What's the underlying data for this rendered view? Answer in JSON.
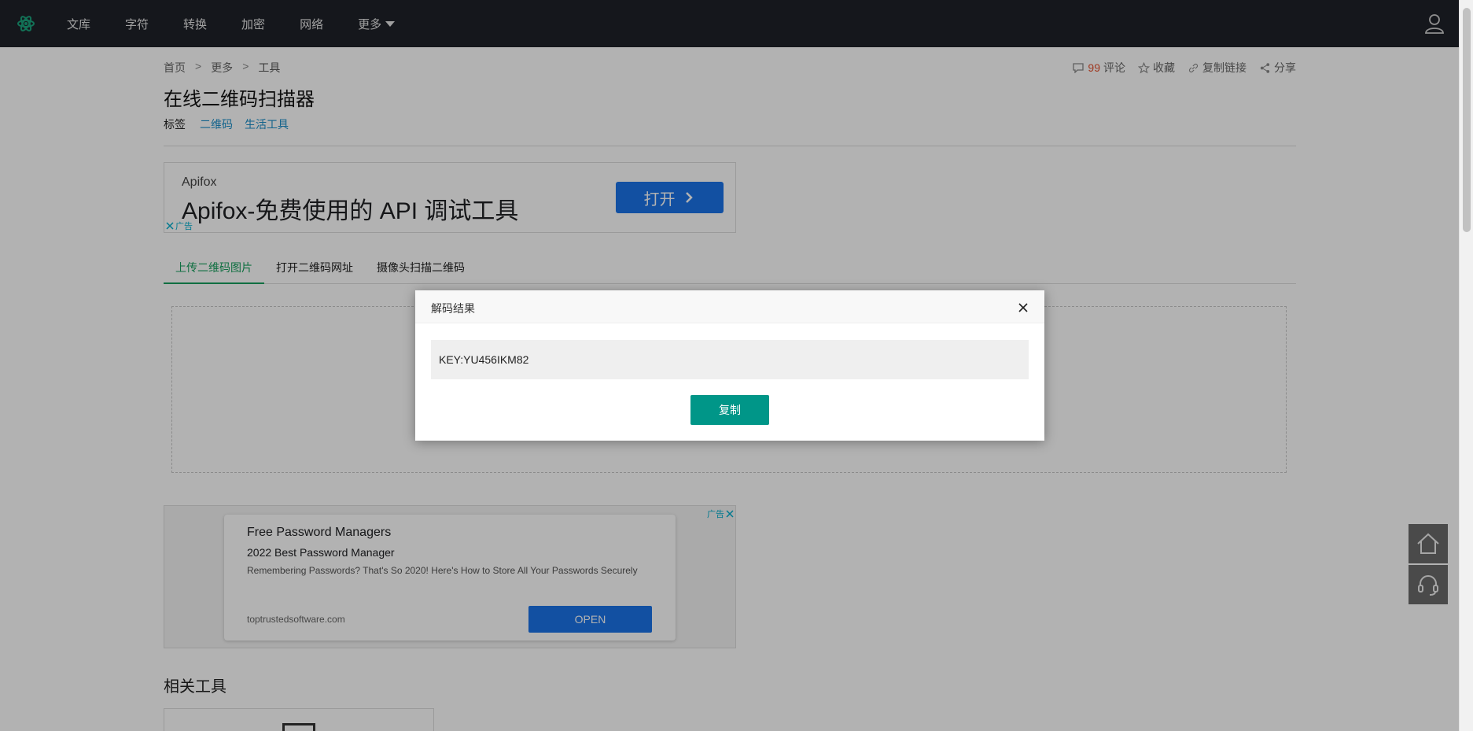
{
  "nav": {
    "items": [
      {
        "label": "文库"
      },
      {
        "label": "字符"
      },
      {
        "label": "转换"
      },
      {
        "label": "加密"
      },
      {
        "label": "网络"
      },
      {
        "label": "更多"
      }
    ]
  },
  "breadcrumb": {
    "items": [
      "首页",
      "更多",
      "工具"
    ],
    "separator": ">"
  },
  "actions": {
    "comment_count": "99",
    "comment_label": "评论",
    "favorite_label": "收藏",
    "copylink_label": "复制链接",
    "share_label": "分享"
  },
  "page": {
    "title": "在线二维码扫描器",
    "tags_label": "标签",
    "tags": [
      "二维码",
      "生活工具"
    ]
  },
  "ad1": {
    "brand": "Apifox",
    "headline": "Apifox-免费使用的 API 调试工具",
    "button": "打开",
    "ad_tag": "广告"
  },
  "tabs": [
    {
      "label": "上传二维码图片"
    },
    {
      "label": "打开二维码网址"
    },
    {
      "label": "摄像头扫描二维码"
    }
  ],
  "ad2": {
    "title": "Free Password Managers",
    "subtitle": "2022 Best Password Manager",
    "description": "Remembering Passwords? That's So 2020! Here's How to Store All Your Passwords Securely",
    "domain": "toptrustedsoftware.com",
    "button": "OPEN",
    "ad_tag": "广告"
  },
  "related": {
    "title": "相关工具"
  },
  "modal": {
    "title": "解码结果",
    "result": "KEY:YU456IKM82",
    "copy_button": "复制"
  },
  "colors": {
    "topbar": "#1f2129",
    "accent_green": "#17a05d",
    "copy_button": "#009688",
    "ad_blue": "#1a73e8",
    "tag_link": "#1a8fc9"
  }
}
